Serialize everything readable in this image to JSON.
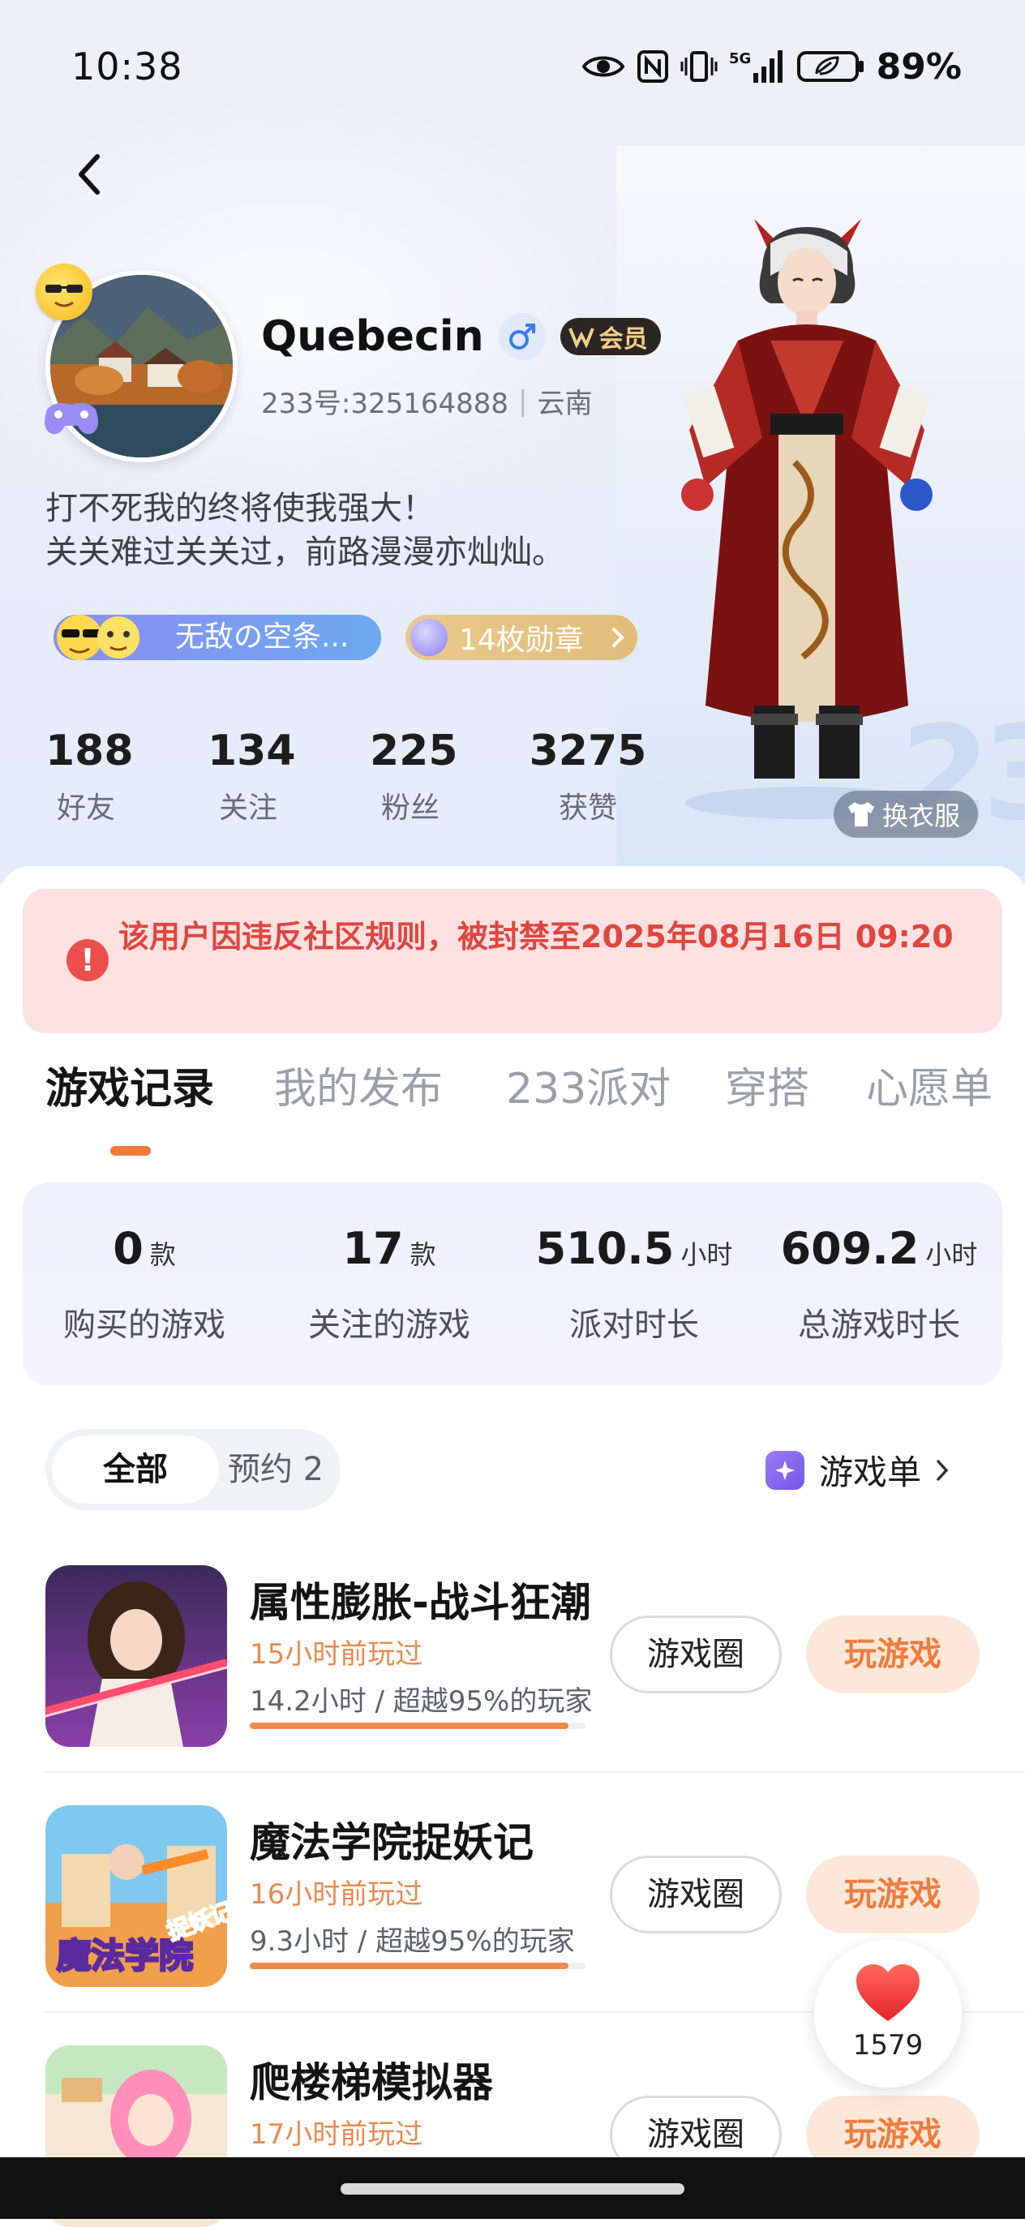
{
  "status_bar": {
    "time": "10:38",
    "network": "5G",
    "battery": "89%"
  },
  "profile": {
    "name": "Quebecin",
    "vip_label": "会员",
    "uid": "233号:325164888",
    "region": "云南",
    "bio_line1": "打不死我的终将使我强大！",
    "bio_line2": "关关难过关关过，前路漫漫亦灿灿。",
    "title_badge": "无敌の空条...",
    "medals": "14枚勋章",
    "outfit_button": "换衣服"
  },
  "stats": [
    {
      "value": "188",
      "label": "好友"
    },
    {
      "value": "134",
      "label": "关注"
    },
    {
      "value": "225",
      "label": "粉丝"
    },
    {
      "value": "3275",
      "label": "获赞"
    }
  ],
  "ban_notice": "该用户因违反社区规则，被封禁至2025年08月16日 09:20",
  "tabs": [
    "游戏记录",
    "我的发布",
    "233派对",
    "穿搭",
    "心愿单"
  ],
  "summary": [
    {
      "value": "0",
      "unit": "款",
      "label": "购买的游戏"
    },
    {
      "value": "17",
      "unit": "款",
      "label": "关注的游戏"
    },
    {
      "value": "510.5",
      "unit": "小时",
      "label": "派对时长"
    },
    {
      "value": "609.2",
      "unit": "小时",
      "label": "总游戏时长"
    }
  ],
  "filter": {
    "all": "全部",
    "reserve": "预约 2"
  },
  "game_list_link": "游戏单",
  "games": [
    {
      "title": "属性膨胀-战斗狂潮",
      "last_played": "15小时前玩过",
      "stats": "14.2小时 / 超越95%的玩家",
      "progress": 0.95,
      "circle_label": "游戏圈",
      "play_label": "玩游戏"
    },
    {
      "title": "魔法学院捉妖记",
      "last_played": "16小时前玩过",
      "stats": "9.3小时 / 超越95%的玩家",
      "progress": 0.95,
      "circle_label": "游戏圈",
      "play_label": "玩游戏",
      "thumb_text": "魔法学院",
      "thumb_tag": "捉妖记"
    },
    {
      "title": "爬楼梯模拟器",
      "last_played": "17小时前玩过",
      "circle_label": "游戏圈",
      "play_label": "玩游戏"
    }
  ],
  "like_count": "1579",
  "colors": {
    "accent": "#ef7b3d",
    "ban_red": "#e0453f",
    "vip_gold": "#f3cf8a"
  }
}
